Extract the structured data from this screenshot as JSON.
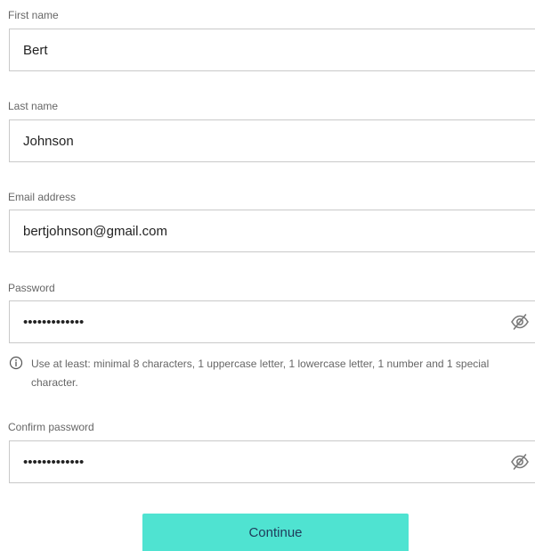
{
  "form": {
    "first_name": {
      "label": "First name",
      "value": "Bert"
    },
    "last_name": {
      "label": "Last name",
      "value": "Johnson"
    },
    "email": {
      "label": "Email address",
      "value": "bertjohnson@gmail.com"
    },
    "password": {
      "label": "Password",
      "value": "•••••••••••••",
      "toggle_icon": "eye-slash-icon"
    },
    "password_hint": {
      "icon": "info-icon",
      "text": "Use at least: minimal 8 characters, 1 uppercase letter, 1 lowercase letter, 1 number and 1 special character."
    },
    "confirm_password": {
      "label": "Confirm password",
      "value": "•••••••••••••",
      "toggle_icon": "eye-slash-icon"
    },
    "continue_label": "Continue"
  },
  "colors": {
    "button_bg": "#4fe3d1",
    "button_text": "#1f3a5a",
    "border": "#c9c9c9",
    "label": "#666666"
  }
}
